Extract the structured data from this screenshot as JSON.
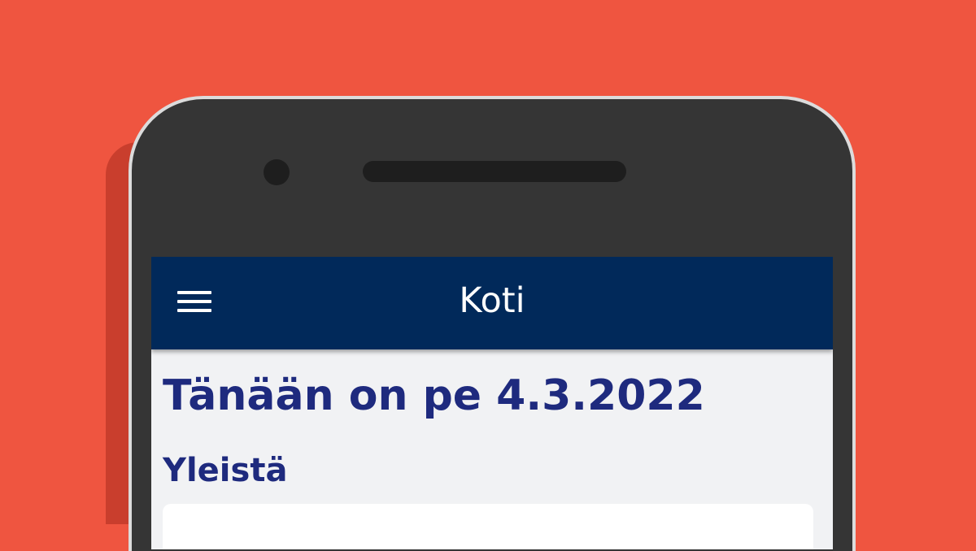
{
  "appbar": {
    "title": "Koti",
    "menu_icon": "hamburger-menu-icon"
  },
  "content": {
    "date_heading": "Tänään on pe 4.3.2022",
    "section_heading": "Yleistä"
  },
  "colors": {
    "background": "#ef5540",
    "phone_body": "#353535",
    "appbar": "#01295a",
    "heading_text": "#1e2a7e",
    "screen_background": "#f1f2f4"
  }
}
